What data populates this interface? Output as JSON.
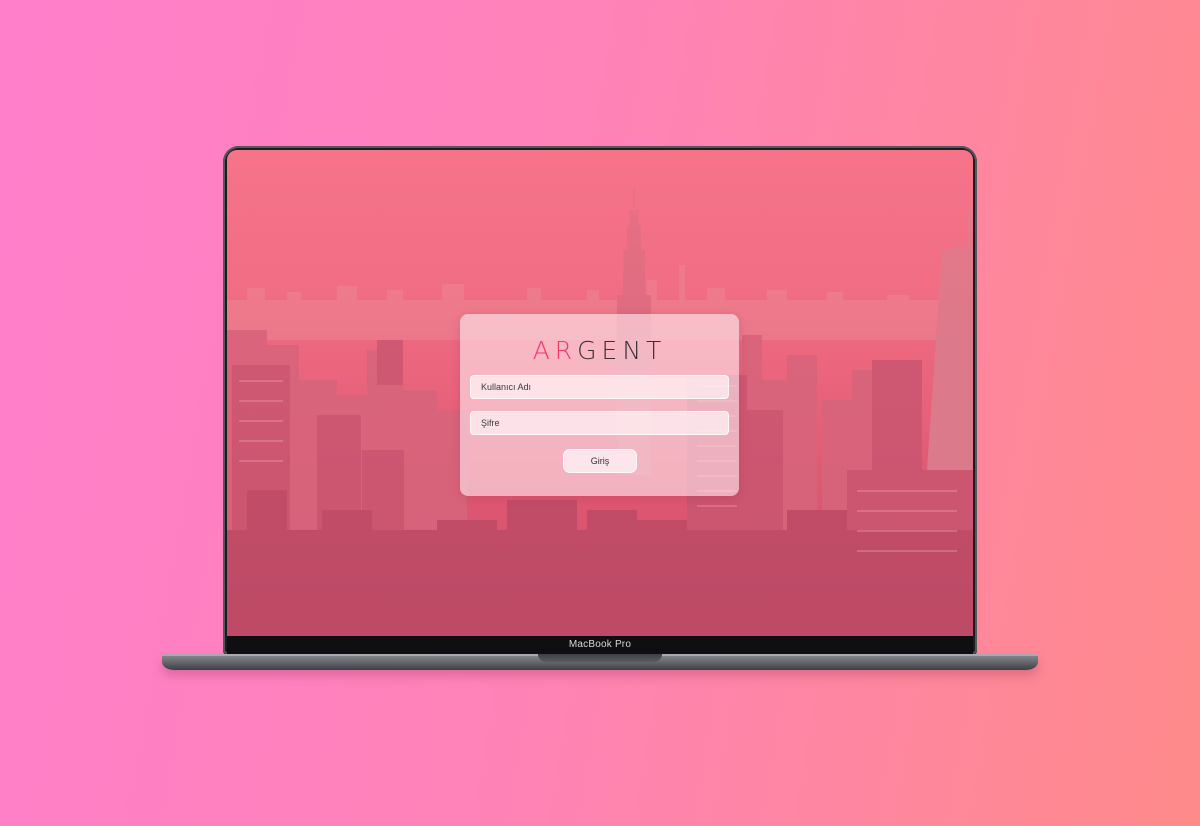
{
  "colors": {
    "background_left": "#ff7fcb",
    "background_right": "#ff8a8a",
    "screen_overlay": "#ee6a80",
    "logo_accent": "#ef3a63",
    "logo_text": "#3b3033",
    "laptop_frame": "#1b1c1f"
  },
  "device": {
    "label": "MacBook Pro"
  },
  "login": {
    "logo_accent": "AR",
    "logo_rest": "GENT",
    "username_placeholder": "Kullanıcı Adı",
    "password_placeholder": "Şifre",
    "submit_label": "Giriş"
  }
}
